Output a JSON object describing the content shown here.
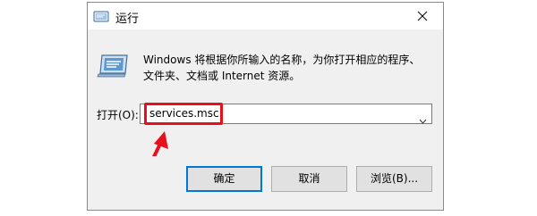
{
  "window": {
    "title": "运行",
    "description_line1": "Windows 将根据你所输入的名称，为你打开相应的程序、",
    "description_line2": "文件夹、文档或 Internet 资源。"
  },
  "open_field": {
    "label": "打开(O):",
    "value": "services.msc"
  },
  "buttons": {
    "ok_label": "确定",
    "cancel_label": "取消",
    "browse_label": "浏览(B)..."
  },
  "colors": {
    "highlight": "#e8101a",
    "focus": "#0078d7"
  },
  "icons": {
    "title": "run-icon",
    "close": "close-icon",
    "dropdown": "chevron-down-icon",
    "annotation": "arrow-annotation"
  }
}
